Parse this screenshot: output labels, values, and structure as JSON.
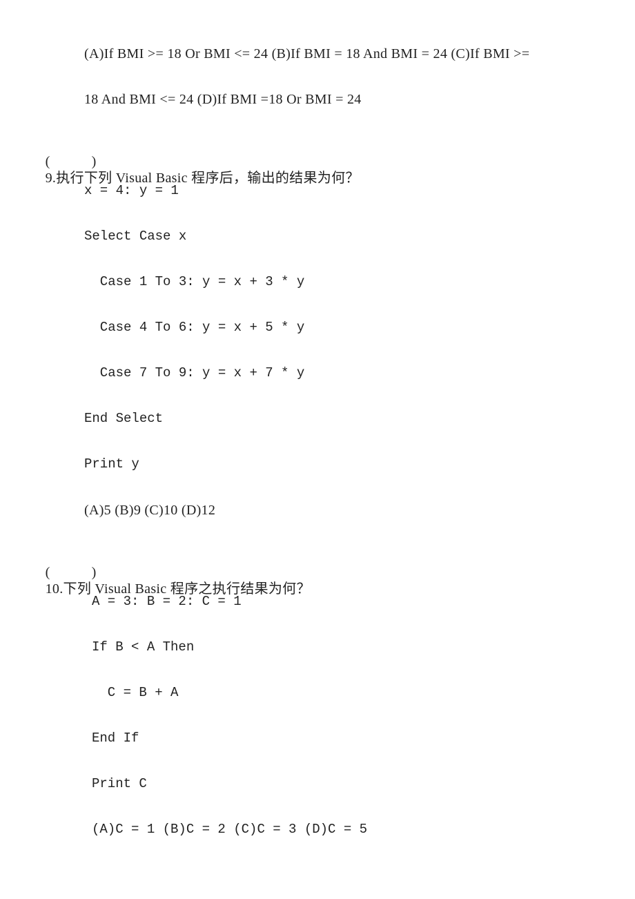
{
  "q8_options": {
    "line1": "(A)If BMI >= 18 Or BMI <= 24 (B)If BMI = 18 And BMI = 24 (C)If BMI >=",
    "line2": "18 And BMI <= 24 (D)If BMI =18 Or BMI = 24"
  },
  "q9": {
    "answer_open": "(",
    "answer_close": ")",
    "number": "9.",
    "question": "执行下列 Visual Basic 程序后，输出的结果为何？",
    "code": [
      "x = 4: y = 1",
      "Select Case x",
      "  Case 1 To 3: y = x + 3 * y",
      "  Case 4 To 6: y = x + 5 * y",
      "  Case 7 To 9: y = x + 7 * y",
      "End Select",
      "Print y"
    ],
    "options": "(A)5 (B)9 (C)10 (D)12"
  },
  "q10": {
    "answer_open": "(",
    "answer_close": ")",
    "number": "10.",
    "question": "下列 Visual Basic 程序之执行结果为何？",
    "code": [
      "A = 3: B = 2: C = 1",
      "If B < A Then",
      "  C = B + A",
      "End If",
      "Print C"
    ],
    "options": "(A)C = 1 (B)C = 2 (C)C = 3 (D)C = 5"
  }
}
